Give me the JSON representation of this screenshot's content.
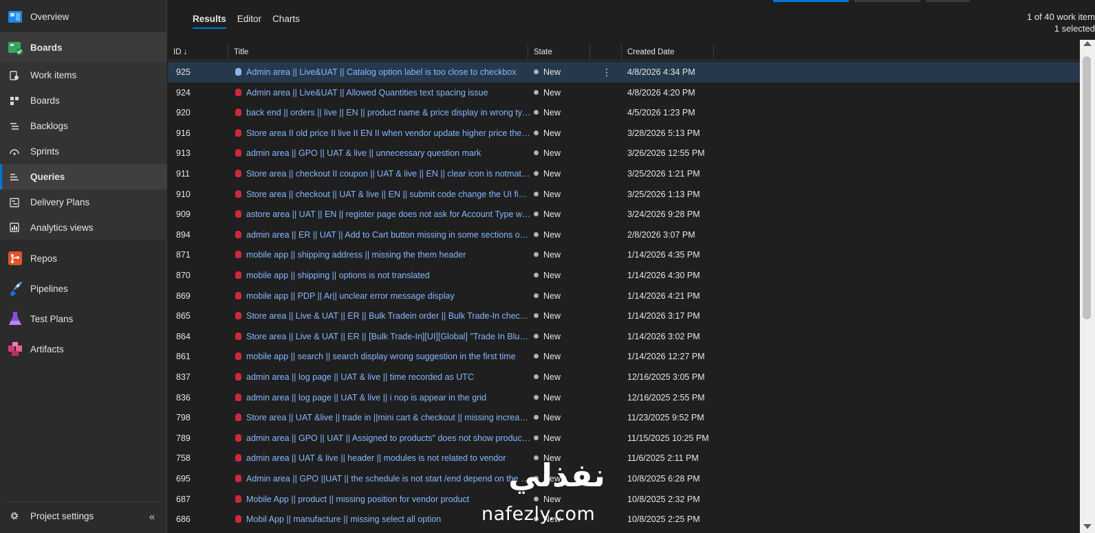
{
  "colors": {
    "accent": "#0078d4",
    "bug": "#cc293d",
    "link": "#86b7ff",
    "selected_row": "#26384b"
  },
  "sidebar": {
    "overview": "Overview",
    "boards_section": "Boards",
    "sub_items": [
      {
        "label": "Work items",
        "icon": "work-items-icon"
      },
      {
        "label": "Boards",
        "icon": "boards-icon"
      },
      {
        "label": "Backlogs",
        "icon": "backlogs-icon"
      },
      {
        "label": "Sprints",
        "icon": "sprints-icon"
      },
      {
        "label": "Queries",
        "icon": "queries-icon"
      },
      {
        "label": "Delivery Plans",
        "icon": "delivery-plans-icon"
      },
      {
        "label": "Analytics views",
        "icon": "analytics-icon"
      }
    ],
    "repos": "Repos",
    "pipelines": "Pipelines",
    "test_plans": "Test Plans",
    "artifacts": "Artifacts",
    "project_settings": "Project settings",
    "collapse": "«"
  },
  "tabs": {
    "results": "Results",
    "editor": "Editor",
    "charts": "Charts"
  },
  "count": {
    "line1": "1 of 40 work item",
    "line2": "1 selected"
  },
  "columns": {
    "id": "ID ↓",
    "title": "Title",
    "state": "State",
    "created": "Created Date"
  },
  "more_glyph": "⋮",
  "rows": [
    {
      "id": "925",
      "title": "Admin area || Live&UAT || Catalog option label is too close to checkbox",
      "state": "New",
      "date": "4/8/2026 4:34 PM"
    },
    {
      "id": "924",
      "title": "Admin area || Live&UAT || Allowed Quantities text spacing issue",
      "state": "New",
      "date": "4/8/2026 4:20 PM"
    },
    {
      "id": "920",
      "title": "back end || orders || live || EN || product name & price display in wrong typical",
      "state": "New",
      "date": "4/5/2026 1:23 PM"
    },
    {
      "id": "916",
      "title": "Store area II old price II live II EN II when vendor update higher price the old…",
      "state": "New",
      "date": "3/28/2026 5:13 PM"
    },
    {
      "id": "913",
      "title": "admin area || GPO || UAT & live || unnecessary question mark",
      "state": "New",
      "date": "3/26/2026 12:55 PM"
    },
    {
      "id": "911",
      "title": "Store area || checkout II coupon || UAT & live || EN || clear icon is notmatch …",
      "state": "New",
      "date": "3/25/2026 1:21 PM"
    },
    {
      "id": "910",
      "title": "Store area || checkout || UAT & live || EN || submit code change the UI field l…",
      "state": "New",
      "date": "3/25/2026 1:13 PM"
    },
    {
      "id": "909",
      "title": "astore area || UAT || EN || register page does not ask for Account Type when …",
      "state": "New",
      "date": "3/24/2026 9:28 PM"
    },
    {
      "id": "894",
      "title": "admin area || ER || UAT || Add to Cart button missing in some sections on pr…",
      "state": "New",
      "date": "2/8/2026 3:07 PM"
    },
    {
      "id": "871",
      "title": "mobile app || shipping address || missing the them header",
      "state": "New",
      "date": "1/14/2026 4:35 PM"
    },
    {
      "id": "870",
      "title": "mobile app || shipping || options is not translated",
      "state": "New",
      "date": "1/14/2026 4:30 PM"
    },
    {
      "id": "869",
      "title": "mobile app || PDP || Ar|| unclear error message display",
      "state": "New",
      "date": "1/14/2026 4:21 PM"
    },
    {
      "id": "865",
      "title": "Store area || Live & UAT || ER || Bulk Tradein order || Bulk Trade-In checkout r…",
      "state": "New",
      "date": "1/14/2026 3:17 PM"
    },
    {
      "id": "864",
      "title": "Store area || Live & UAT || ER || [Bulk Trade-In][UI][Global] \"Trade In Bluk\" typ…",
      "state": "New",
      "date": "1/14/2026 3:02 PM"
    },
    {
      "id": "861",
      "title": "mobile app || search || search display wrong suggestion in the first time",
      "state": "New",
      "date": "1/14/2026 12:27 PM"
    },
    {
      "id": "837",
      "title": "admin area || log page || UAT & live || time recorded as UTC",
      "state": "New",
      "date": "12/16/2025 3:05 PM"
    },
    {
      "id": "836",
      "title": "admin area || log page || UAT & live || i nop is appear in the grid",
      "state": "New",
      "date": "12/16/2025 2:55 PM"
    },
    {
      "id": "798",
      "title": "Store area || UAT &live || trade in ||mini cart & checkout || missing increase q…",
      "state": "New",
      "date": "11/23/2025 9:52 PM"
    },
    {
      "id": "789",
      "title": "admin area || GPO || UAT || Assigned to products\" does not show product se…",
      "state": "New",
      "date": "11/15/2025 10:25 PM"
    },
    {
      "id": "758",
      "title": "admin area || UAT & live || header || modules is not related to vendor",
      "state": "New",
      "date": "11/6/2025 2:11 PM"
    },
    {
      "id": "695",
      "title": "Admin area || GPO ||UAT || the schedule is not start /end depend on the sum…",
      "state": "New",
      "date": "10/8/2025 6:28 PM"
    },
    {
      "id": "687",
      "title": "Mobile App || product || missing position for vendor product",
      "state": "New",
      "date": "10/8/2025 2:32 PM"
    },
    {
      "id": "686",
      "title": "Mobil App || manufacture || missing select all option",
      "state": "New",
      "date": "10/8/2025 2:25 PM"
    }
  ],
  "watermark": {
    "latin": "nafezly.com",
    "arabic": "نفذلي"
  }
}
